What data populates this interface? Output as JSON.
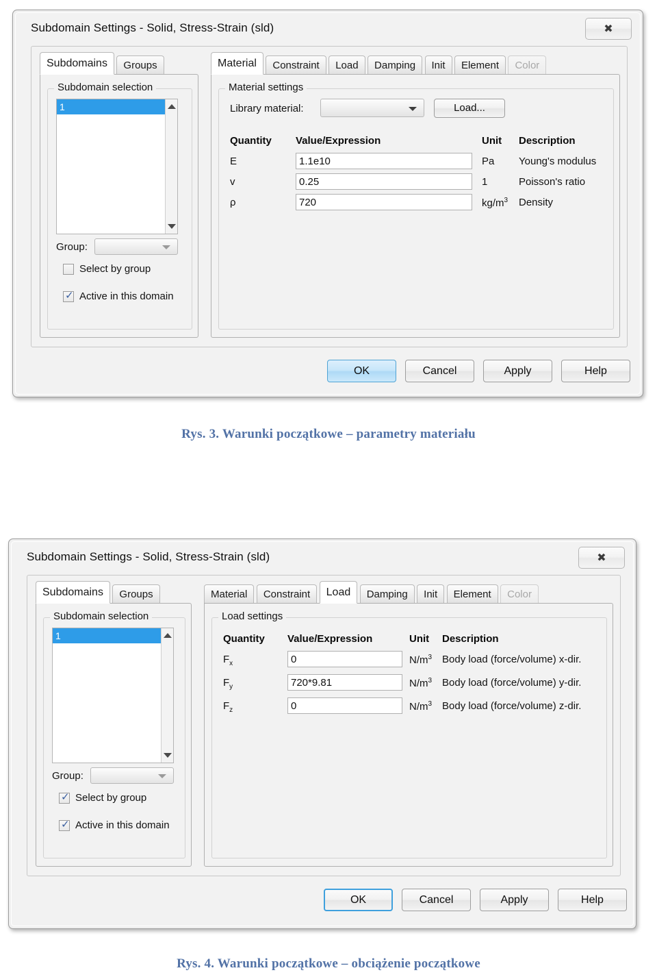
{
  "figures": [
    {
      "id": "fig3",
      "window": {
        "title": "Subdomain Settings - Solid, Stress-Strain (sld)",
        "close_icon": "close-icon",
        "close_glyph": "✖"
      },
      "left_tabs": [
        {
          "label": "Subdomains",
          "active": true
        },
        {
          "label": "Groups",
          "active": false
        }
      ],
      "left_group_label": "Subdomain selection",
      "listbox": {
        "items": [
          "1"
        ],
        "selected_index": 0
      },
      "group_field": {
        "label": "Group:",
        "value": ""
      },
      "checkboxes": [
        {
          "label": "Select by group",
          "checked": false
        },
        {
          "label": "Active in this domain",
          "checked": true
        }
      ],
      "right_tabs": [
        {
          "label": "Material",
          "active": true,
          "disabled": false
        },
        {
          "label": "Constraint",
          "active": false,
          "disabled": false
        },
        {
          "label": "Load",
          "active": false,
          "disabled": false
        },
        {
          "label": "Damping",
          "active": false,
          "disabled": false
        },
        {
          "label": "Init",
          "active": false,
          "disabled": false
        },
        {
          "label": "Element",
          "active": false,
          "disabled": false
        },
        {
          "label": "Color",
          "active": false,
          "disabled": true
        }
      ],
      "right_group_label": "Material settings",
      "library_material": {
        "label": "Library material:",
        "value": ""
      },
      "load_button": "Load...",
      "table": {
        "headers": [
          "Quantity",
          "Value/Expression",
          "Unit",
          "Description"
        ],
        "rows": [
          {
            "quantity": "E",
            "quantity_sub": "",
            "value": "1.1e10",
            "unit": "Pa",
            "unit_sup": "",
            "description": "Young's modulus"
          },
          {
            "quantity": "v",
            "quantity_sub": "",
            "value": "0.25",
            "unit": "1",
            "unit_sup": "",
            "description": "Poisson's ratio"
          },
          {
            "quantity": "ρ",
            "quantity_sub": "",
            "value": "720",
            "unit": "kg/m",
            "unit_sup": "3",
            "description": "Density"
          }
        ]
      },
      "buttons": [
        {
          "label": "OK",
          "style": "default-blue"
        },
        {
          "label": "Cancel",
          "style": "normal"
        },
        {
          "label": "Apply",
          "style": "normal"
        },
        {
          "label": "Help",
          "style": "normal"
        }
      ],
      "caption": "Rys. 3. Warunki początkowe – parametry materiału"
    },
    {
      "id": "fig4",
      "window": {
        "title": "Subdomain Settings - Solid, Stress-Strain (sld)",
        "close_icon": "close-icon",
        "close_glyph": "✖"
      },
      "left_tabs": [
        {
          "label": "Subdomains",
          "active": true
        },
        {
          "label": "Groups",
          "active": false
        }
      ],
      "left_group_label": "Subdomain selection",
      "listbox": {
        "items": [
          "1"
        ],
        "selected_index": 0
      },
      "group_field": {
        "label": "Group:",
        "value": ""
      },
      "checkboxes": [
        {
          "label": "Select by group",
          "checked": true
        },
        {
          "label": "Active in this domain",
          "checked": true
        }
      ],
      "right_tabs": [
        {
          "label": "Material",
          "active": false,
          "disabled": false
        },
        {
          "label": "Constraint",
          "active": false,
          "disabled": false
        },
        {
          "label": "Load",
          "active": true,
          "disabled": false
        },
        {
          "label": "Damping",
          "active": false,
          "disabled": false
        },
        {
          "label": "Init",
          "active": false,
          "disabled": false
        },
        {
          "label": "Element",
          "active": false,
          "disabled": false
        },
        {
          "label": "Color",
          "active": false,
          "disabled": true
        }
      ],
      "right_group_label": "Load settings",
      "table": {
        "headers": [
          "Quantity",
          "Value/Expression",
          "Unit",
          "Description"
        ],
        "rows": [
          {
            "quantity": "F",
            "quantity_sub": "x",
            "value": "0",
            "unit": "N/m",
            "unit_sup": "3",
            "description": "Body load (force/volume) x-dir."
          },
          {
            "quantity": "F",
            "quantity_sub": "y",
            "value": "720*9.81",
            "unit": "N/m",
            "unit_sup": "3",
            "description": "Body load (force/volume) y-dir."
          },
          {
            "quantity": "F",
            "quantity_sub": "z",
            "value": "0",
            "unit": "N/m",
            "unit_sup": "3",
            "description": "Body load (force/volume) z-dir."
          }
        ]
      },
      "buttons": [
        {
          "label": "OK",
          "style": "focus-ring"
        },
        {
          "label": "Cancel",
          "style": "normal"
        },
        {
          "label": "Apply",
          "style": "normal"
        },
        {
          "label": "Help",
          "style": "normal"
        }
      ],
      "caption": "Rys. 4. Warunki początkowe – obciążenie początkowe"
    }
  ],
  "colors": {
    "selection_blue": "#2e9ce8",
    "caption_blue": "#5272a6",
    "dialog_face": "#f2f2f2",
    "focus_blue": "#3fa0dd"
  }
}
